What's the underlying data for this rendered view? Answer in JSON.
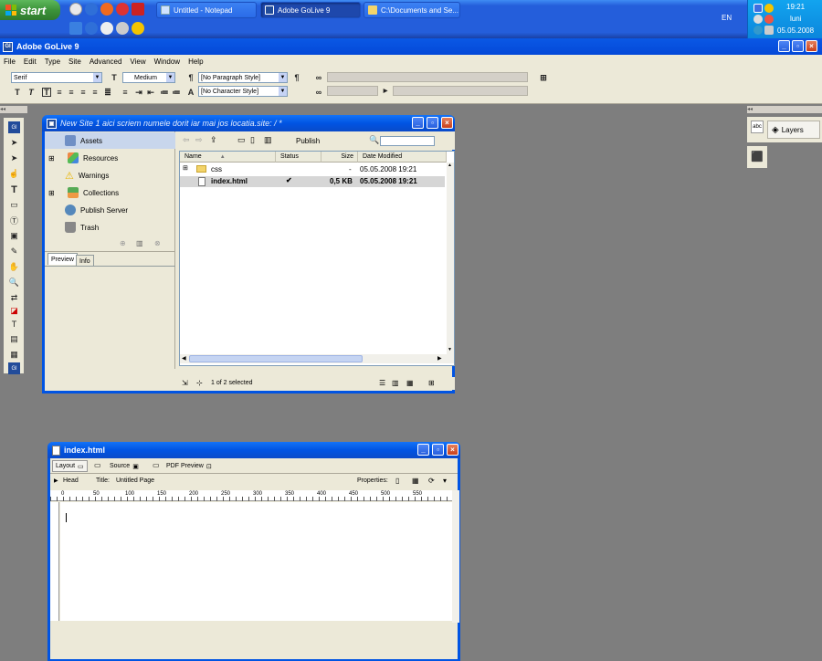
{
  "taskbar": {
    "start_label": "start",
    "tasks": [
      {
        "label": "Untitled - Notepad",
        "active": false
      },
      {
        "label": "Adobe GoLive 9",
        "active": true
      },
      {
        "label": "C:\\Documents and Se...",
        "active": false
      }
    ],
    "language": "EN",
    "time": "19:21",
    "day": "luni",
    "date": "05.05.2008"
  },
  "app": {
    "title": "Adobe GoLive 9",
    "menu": [
      "File",
      "Edit",
      "Type",
      "Site",
      "Advanced",
      "View",
      "Window",
      "Help"
    ],
    "toolbar": {
      "font": "Serif",
      "size": "Medium",
      "paragraph_style": "[No Paragraph Style]",
      "character_style": "[No Character Style]"
    }
  },
  "site_window": {
    "title": "New Site 1 aici scriem numele dorit iar mai jos locatia.site: / *",
    "sidebar": [
      {
        "label": "Assets",
        "expandable": false
      },
      {
        "label": "Resources",
        "expandable": true
      },
      {
        "label": "Warnings",
        "expandable": false
      },
      {
        "label": "Collections",
        "expandable": true
      },
      {
        "label": "Publish Server",
        "expandable": false
      },
      {
        "label": "Trash",
        "expandable": false
      }
    ],
    "tabs": [
      "Preview",
      "Info"
    ],
    "publish_label": "Publish",
    "columns": [
      "Name",
      "Status",
      "Size",
      "Date Modified"
    ],
    "files": [
      {
        "name": "css",
        "status": "",
        "size": "-",
        "date": "05.05.2008 19:21"
      },
      {
        "name": "index.html",
        "status": "✔",
        "size": "0,5 KB",
        "date": "05.05.2008 19:21"
      }
    ],
    "status": "1 of 2 selected"
  },
  "right_panel": {
    "layers_label": "Layers"
  },
  "doc_window": {
    "title": "index.html",
    "tabs": [
      "Layout",
      "Source",
      "PDF Preview"
    ],
    "head_label": "Head",
    "title_label": "Title:",
    "page_title": "Untitled Page",
    "properties_label": "Properties:",
    "ruler": [
      "0",
      "50",
      "100",
      "150",
      "200",
      "250",
      "300",
      "350",
      "400",
      "450",
      "500",
      "550"
    ]
  }
}
